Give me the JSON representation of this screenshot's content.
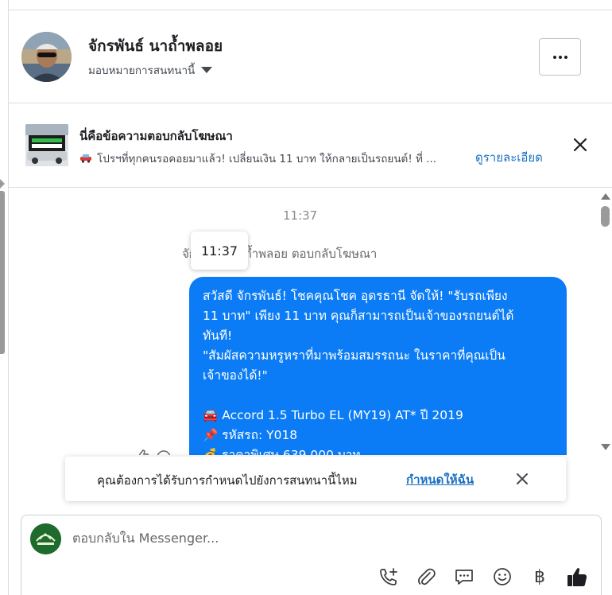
{
  "header": {
    "contact_name": "จักรพันธ์ นาถ้ำพลอย",
    "assign_label": "มอบหมายการสนทนานี้"
  },
  "ad_reply": {
    "title": "นี่คือข้อความตอบกลับโฆษณา",
    "preview": "โปรฯที่ทุกคนรอคอยมาแล้ว! เปลี่ยนเงิน 11 บาท ให้กลายเป็นรถยนต์! ที่ ...",
    "details_link": "ดูรายละเอียด"
  },
  "conversation": {
    "timestamp": "11:37",
    "tooltip_time": "11:37",
    "ad_reply_note": "จักรพันธ์ นาถ้ำพลอย ตอบกลับโฆษณา",
    "message": {
      "line1": "สวัสดี จักรพันธ์! โชคคุณโชค อุดรธานี จัดให้! \"รับรถเพียง",
      "line2": "11 บาท\" เพียง 11 บาท คุณก็สามารถเป็นเจ้าของรถยนต์ได้",
      "line3": "ทันที!",
      "line4": "\"สัมผัสความหรูหราที่มาพร้อมสมรรถนะ ในราคาที่คุณเป็น",
      "line5": "เจ้าของได้!\"",
      "car_emoji": "🚘",
      "car": "Accord 1.5 Turbo EL (MY19) AT* ปี 2019",
      "pin_emoji": "📌",
      "code": "รหัสรถ: Y018",
      "money_emoji": "💰",
      "price": "ราคาพิเศษ 639,000 บาท"
    }
  },
  "toast": {
    "text": "คุณต้องการได้รับการกำหนดไปยังการสนทนานี้ไหม",
    "link": "กำหนดให้ฉัน"
  },
  "composer": {
    "placeholder": "ตอบกลับใน Messenger...",
    "currency_symbol": "฿"
  },
  "colors": {
    "bubble": "#0b7cf5",
    "link": "#1a6fc2"
  }
}
